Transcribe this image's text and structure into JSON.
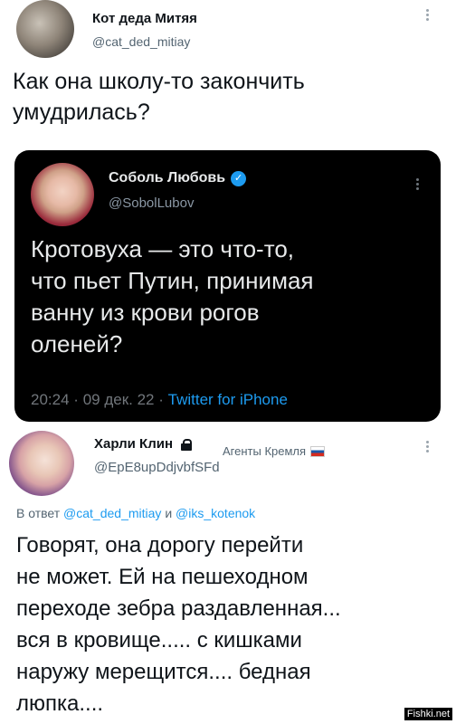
{
  "tweet": {
    "author_name": "Кот деда Митяя",
    "author_handle": "@cat_ded_mitiay",
    "text": "Как она школу-то закончить\nумудрилась?"
  },
  "quoted": {
    "author_name": "Соболь Любовь",
    "author_handle": "@SobolLubov",
    "text": "Кротовуха — это что-то,\nчто пьет Путин, принимая\nванну из крови рогов\nоленей?",
    "time": "20:24",
    "date": "09 дек. 22",
    "source": "Twitter for iPhone",
    "separator": "·",
    "verified_mark": "✓"
  },
  "reply": {
    "author_name": "Харли Клин",
    "author_handle": "@EpE8upDdjvbfSFd",
    "badge": "Агенты Кремля",
    "reply_prefix": "В ответ",
    "reply_user1": "@cat_ded_mitiay",
    "reply_and": "и",
    "reply_user2": "@iks_kotenok",
    "text": "Говорят, она дорогу перейти\nне может.  Ей на пешеходном\nпереходе зебра раздавленная...\nвся в кровище..... с кишками\nнаружу мерещится.... бедная\nлюпка...."
  },
  "watermark": "Fishki.net",
  "colors": {
    "link": "#1d9bf0",
    "dark_card": "#000000",
    "muted": "#536471"
  },
  "icons": [
    "more-options-icon",
    "verified-badge-icon",
    "lock-icon",
    "russian-flag-icon"
  ]
}
